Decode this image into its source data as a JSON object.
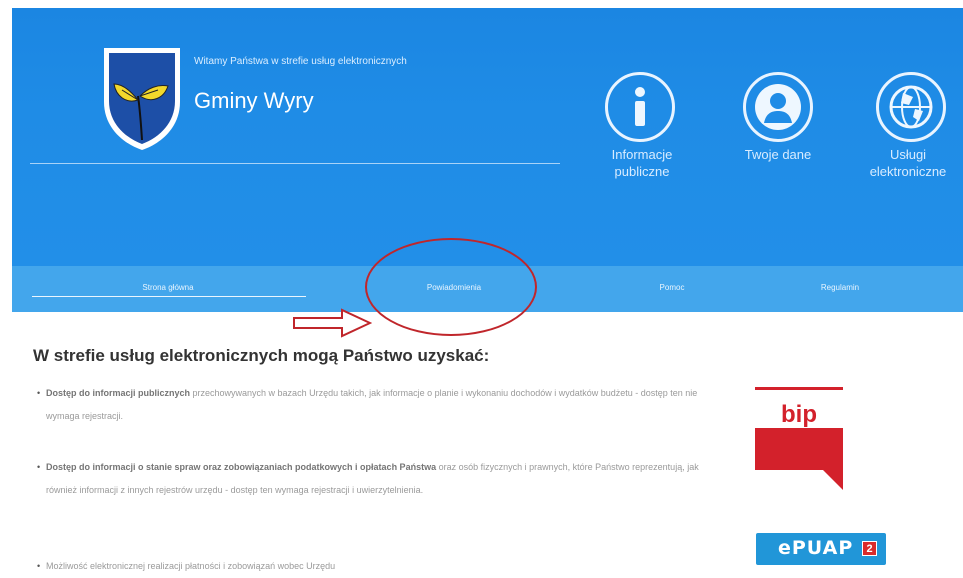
{
  "header": {
    "welcome_text": "Witamy Państwa w strefie usług elektronicznych",
    "brand_name": "Gminy Wyry"
  },
  "quick_links": [
    {
      "label": "Informacje\npubliczne",
      "icon": "info-icon"
    },
    {
      "label": "Twoje dane",
      "icon": "user-icon"
    },
    {
      "label": "Usługi\nelektroniczne",
      "icon": "globe-icon"
    }
  ],
  "nav": {
    "items": [
      "Strona główna",
      "Powiadomienia",
      "Pomoc",
      "Regulamin"
    ],
    "active_index": 0
  },
  "content": {
    "heading": "W strefie usług elektronicznych mogą Państwo uzyskać:",
    "bullets": [
      {
        "bold": "Dostęp do informacji publicznych",
        "text": " przechowywanych w bazach Urzędu takich, jak informacje o planie i wykonaniu dochodów i wydatków budżetu - dostęp ten nie wymaga rejestracji."
      },
      {
        "bold": "Dostęp do informacji o stanie spraw oraz zobowiązaniach podatkowych i opłatach Państwa",
        "text": " oraz osób fizycznych i prawnych, które Państwo reprezentują, jak również informacji z innych rejestrów urzędu - dostęp ten wymaga rejestracji i uwierzytelnienia."
      },
      {
        "bold": "",
        "text": "Możliwość elektronicznej realizacji płatności i zobowiązań wobec Urzędu"
      }
    ]
  },
  "sidebar": {
    "bip_label": "bip",
    "epuap_label": "ePUAP",
    "epuap_badge": "2"
  },
  "colors": {
    "header_blue": "#1f8ce6",
    "nav_blue": "#43a6ec",
    "annotation_red": "#c0262b",
    "bip_red": "#d3212b"
  }
}
